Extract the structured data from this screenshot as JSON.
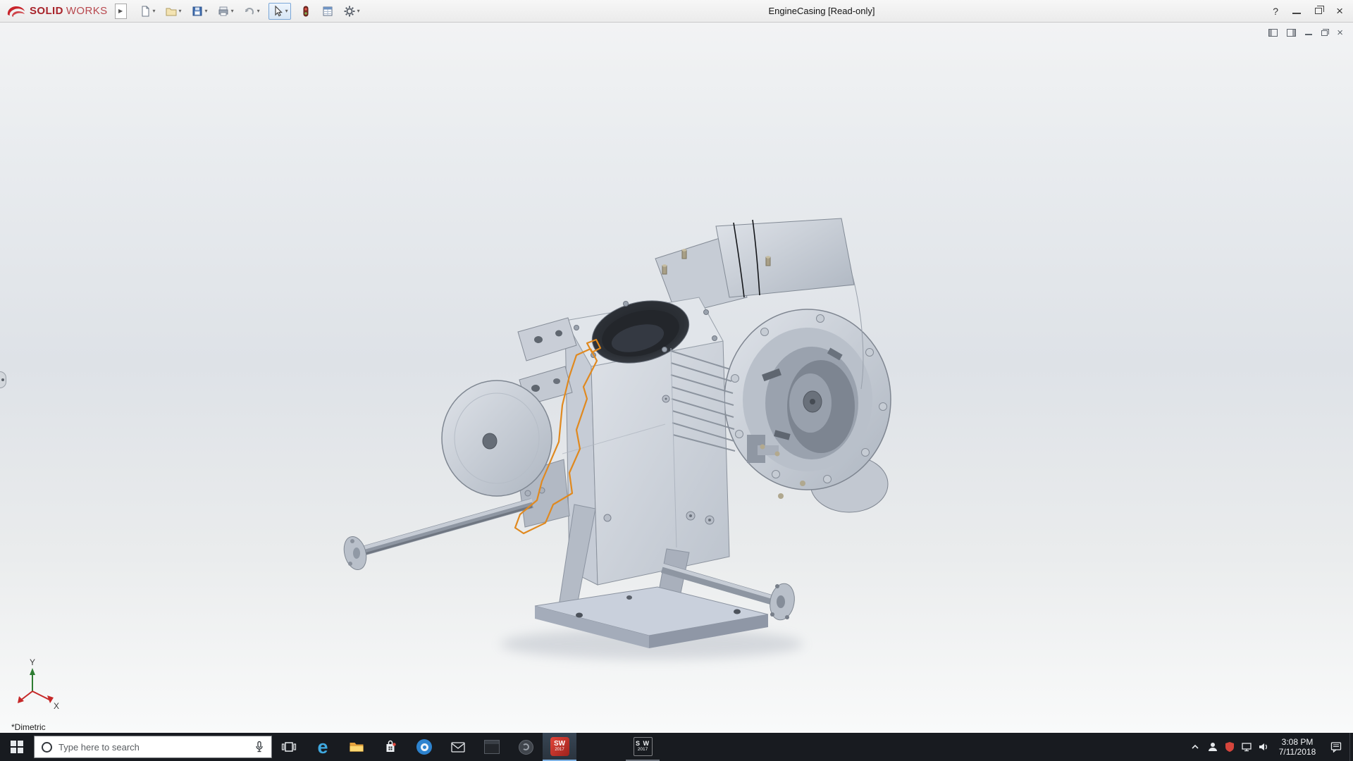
{
  "titlebar": {
    "document_title": "EngineCasing [Read-only]",
    "help_glyph": "?",
    "logo": {
      "bold": "SOLID",
      "light": "WORKS"
    },
    "expand_glyph": "▶",
    "caret_glyph": "▾",
    "toolbar_items": [
      "new-document",
      "open-document",
      "save",
      "print",
      "undo",
      "select",
      "rebuild",
      "file-properties",
      "options"
    ]
  },
  "document_window": {
    "controls": [
      "feature-pane",
      "display-pane",
      "minimize",
      "restore",
      "close"
    ]
  },
  "viewport": {
    "view_orientation": "*Dimetric",
    "triad": {
      "x_label": "X",
      "y_label": "Y"
    }
  },
  "taskbar": {
    "search": {
      "placeholder": "Type here to search"
    },
    "apps": [
      "task-view",
      "edge",
      "file-explorer",
      "store",
      "browser-blue",
      "mail",
      "terminal",
      "app-gray",
      "solidworks-2017",
      "solidworks-window"
    ],
    "edge_glyph": "e",
    "sw_badge": {
      "line1": "SW",
      "line2": "2017"
    },
    "sw_badge2": {
      "line1": "S W",
      "line2": "2017"
    },
    "tray": {
      "time": "3:08 PM",
      "date": "7/11/2018"
    }
  },
  "colors": {
    "taskbar_bg": "#181b20",
    "menubar_bg": "#f2f2f2",
    "logo_red": "#a8232a",
    "sketch_orange": "#e0891f",
    "active_app_accent": "#7fb2e5"
  }
}
